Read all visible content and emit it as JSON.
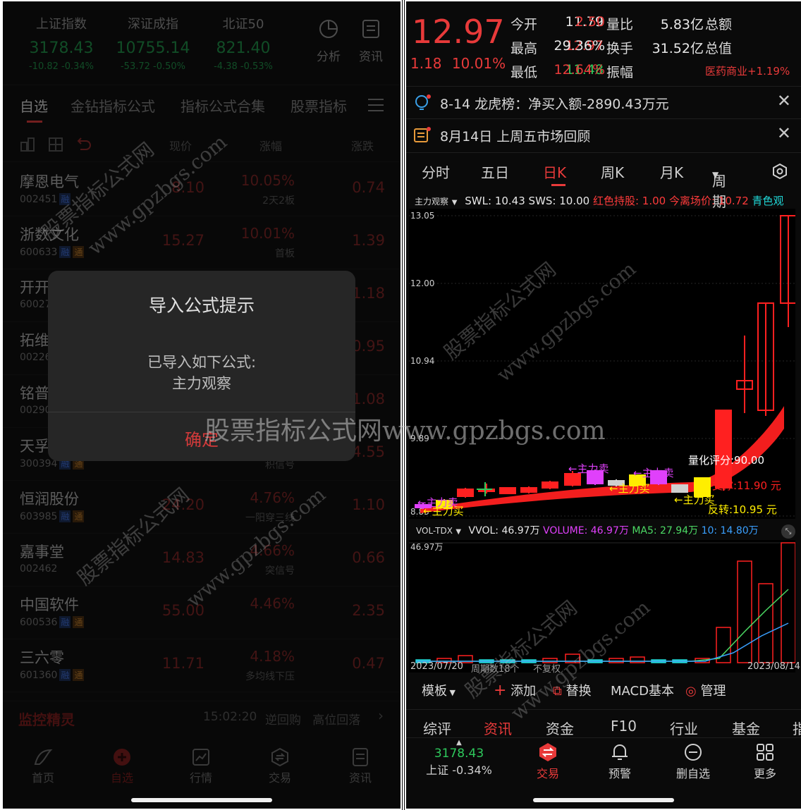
{
  "left": {
    "indices": [
      {
        "name": "上证指数",
        "value": "3178.43",
        "change": "-10.82  -0.34%"
      },
      {
        "name": "深证成指",
        "value": "10755.14",
        "change": "-53.72  -0.50%"
      },
      {
        "name": "北证50",
        "value": "821.40",
        "change": "-4.38  -0.53%"
      }
    ],
    "top_icons": [
      {
        "label": "分析",
        "icon": "pie-chart-icon"
      },
      {
        "label": "资讯",
        "icon": "news-icon"
      }
    ],
    "tabs": [
      "自选",
      "金钻指标公式",
      "指标公式合集",
      "股票指标"
    ],
    "columns": {
      "price": "现价",
      "change_pct": "涨幅",
      "change": "涨跌"
    },
    "stocks": [
      {
        "name": "摩恩电气",
        "code": "002451",
        "tags": [
          "融"
        ],
        "price": "8.10",
        "pct": "10.05%",
        "sub": "2天2板",
        "chg": "0.74"
      },
      {
        "name": "浙数文化",
        "code": "600633",
        "tags": [
          "融",
          "通"
        ],
        "price": "15.27",
        "pct": "10.01%",
        "sub": "首板",
        "chg": "1.39"
      },
      {
        "name": "开开",
        "code": "60027",
        "tags": [],
        "price": "",
        "pct": "",
        "sub": "",
        "chg": "1.18"
      },
      {
        "name": "拓维",
        "code": "00226",
        "tags": [],
        "price": "",
        "pct": "",
        "sub": "",
        "chg": "0.95"
      },
      {
        "name": "铭普",
        "code": "00290",
        "tags": [],
        "price": "",
        "pct": "",
        "sub": "",
        "chg": "1.08"
      },
      {
        "name": "天孚",
        "code": "300394",
        "tags": [
          "融",
          "通"
        ],
        "price": "",
        "pct": "",
        "sub": "积信号",
        "chg": "4.55"
      },
      {
        "name": "恒润股份",
        "code": "603985",
        "tags": [
          "融",
          "通"
        ],
        "price": "24.20",
        "pct": "4.76%",
        "sub": "一阳穿三线",
        "chg": "1.10"
      },
      {
        "name": "嘉事堂",
        "code": "002462",
        "tags": [],
        "price": "14.83",
        "pct": "4.66%",
        "sub": "突信号",
        "chg": "0.66"
      },
      {
        "name": "中国软件",
        "code": "600536",
        "tags": [
          "融",
          "通"
        ],
        "price": "55.00",
        "pct": "4.46%",
        "sub": "",
        "chg": "2.35"
      },
      {
        "name": "三六零",
        "code": "601360",
        "tags": [
          "融",
          "通"
        ],
        "price": "11.71",
        "pct": "4.18%",
        "sub": "多均线下压",
        "chg": "0.47"
      }
    ],
    "monitor": {
      "title": "监控精灵",
      "time": "15:02:20",
      "items": "逆回购   高位回落"
    },
    "dialog": {
      "title": "导入公式提示",
      "line1": "已导入如下公式:",
      "line2": "主力观察",
      "ok": "确定"
    },
    "nav": [
      "首页",
      "自选",
      "行情",
      "交易",
      "资讯"
    ]
  },
  "right": {
    "price": "12.97",
    "change": "1.18",
    "change_pct": "10.01%",
    "stats": [
      [
        {
          "label": "今开",
          "value": "11.79",
          "color": "white"
        },
        {
          "label": "量比",
          "value": "2.50",
          "color": "up"
        },
        {
          "label": "总额",
          "value": "5.83亿",
          "color": "white"
        }
      ],
      [
        {
          "label": "最高",
          "value": "12.97",
          "color": "up"
        },
        {
          "label": "换手",
          "value": "29.36%",
          "color": "white"
        },
        {
          "label": "总值",
          "value": "31.52亿",
          "color": "white"
        }
      ],
      [
        {
          "label": "最低",
          "value": "11.48",
          "color": "down"
        },
        {
          "label": "振幅",
          "value": "12.64%",
          "color": "up"
        }
      ]
    ],
    "sector": "医药商业+1.19%",
    "notices": [
      "8-14 龙虎榜：净买入额-2890.43万元",
      "8月14日 上周五市场回顾"
    ],
    "period_tabs": [
      "分时",
      "五日",
      "日K",
      "周K",
      "月K",
      "周期"
    ],
    "active_period": "日K",
    "indicator": {
      "name": "主力观察",
      "swl": "SWL: 10.43",
      "sws": "SWS: 10.00",
      "red": "红色持股: 1.00",
      "leave": "今离场价: 10.72",
      "cyan": "青色观"
    },
    "kline_axis": [
      "13.05",
      "12.00",
      "10.94",
      "9.89",
      "8.83"
    ],
    "kline_labels": {
      "score": "量化评分:90.00",
      "support": "支撑:11.90 元",
      "reversal": "反转:10.95 元",
      "buy1": "←主力买",
      "buy2": "←主力买",
      "buy3": "←主力买",
      "sell1": "←主力卖",
      "sell2": "←主力卖",
      "sell3": "←主力卖"
    },
    "vol": {
      "name": "VOL-TDX",
      "vvol": "VVOL: 46.97万",
      "volume": "VOLUME: 46.97万",
      "ma5": "MA5: 27.94万",
      "ma10": "10: 14.80万",
      "top": "46.97万"
    },
    "date_start": "2023/07/20",
    "period_count": "周期数18个",
    "adjust": "不复权",
    "date_end": "2023/08/14",
    "tools": [
      "模板",
      "添加",
      "替换",
      "MACD基本",
      "管理"
    ],
    "detail_tabs": [
      "综评",
      "资讯",
      "资金",
      "F10",
      "行业",
      "基金",
      "指"
    ],
    "active_detail": "资讯",
    "index_value": "3178.43",
    "index_label": "上证 -0.34%",
    "nav": [
      "交易",
      "预警",
      "删自选",
      "更多"
    ]
  },
  "watermark": {
    "main": "股票指标公式网www.gpzbgs.com",
    "diag1": "股票指标公式网",
    "diag2": "www.gpzbgs.com"
  },
  "chart_data": {
    "type": "candlestick",
    "title": "",
    "xlabel": "",
    "ylabel": "",
    "x": [
      "2023/07/20",
      "...",
      "2023/08/14"
    ],
    "ylim": [
      8.83,
      13.05
    ],
    "candles_visible_highs_lows": {
      "last_close": 12.97,
      "last_high": 12.97,
      "last_low": 11.48
    },
    "volume_top": "46.97万"
  }
}
